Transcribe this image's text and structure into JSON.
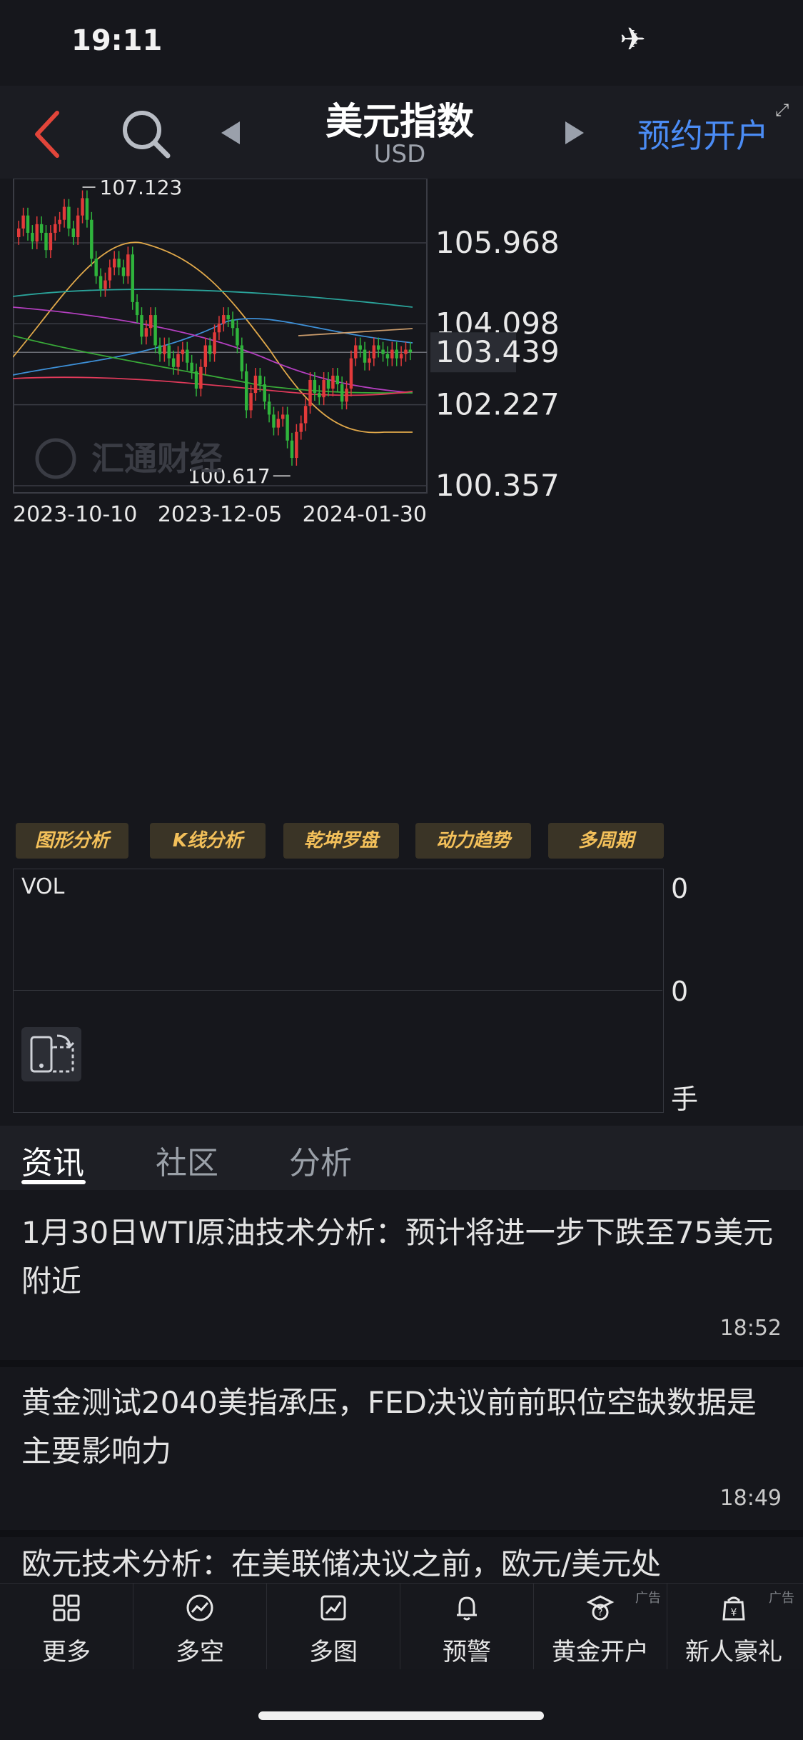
{
  "status_bar": {
    "time": "19:11"
  },
  "nav": {
    "title": "美元指数",
    "subtitle": "USD",
    "reserve_label": "预约开户"
  },
  "chart": {
    "y_axis_labels": [
      "105.968",
      "104.098",
      "103.439",
      "102.227",
      "100.357"
    ],
    "x_axis_labels": [
      "2023-10-10",
      "2023-12-05",
      "2024-01-30"
    ],
    "high_label": "107.123",
    "low_label": "100.617",
    "watermark": "汇通财经"
  },
  "chart_data": {
    "type": "candlestick",
    "x_start": "2023-10-10",
    "x_end": "2024-01-30",
    "ylim": [
      100.357,
      107.123
    ],
    "current": 103.439,
    "closes": [
      106.3,
      106.6,
      106.2,
      106.0,
      106.4,
      106.2,
      105.8,
      106.2,
      106.4,
      106.5,
      106.8,
      106.3,
      106.1,
      106.6,
      107.0,
      106.5,
      105.6,
      105.2,
      104.9,
      105.1,
      105.4,
      105.6,
      105.4,
      105.2,
      105.7,
      104.6,
      104.3,
      103.8,
      104.0,
      104.3,
      103.6,
      103.4,
      103.6,
      103.3,
      103.1,
      103.4,
      103.5,
      103.2,
      103.0,
      102.6,
      103.1,
      103.6,
      103.4,
      103.9,
      104.1,
      104.3,
      104.2,
      104.0,
      103.6,
      103.0,
      102.1,
      102.5,
      102.9,
      102.7,
      102.3,
      102.0,
      101.7,
      101.9,
      102.0,
      101.4,
      101.0,
      101.6,
      101.8,
      102.2,
      102.8,
      102.5,
      102.4,
      102.8,
      102.6,
      102.9,
      102.7,
      102.3,
      102.6,
      103.3,
      103.6,
      103.5,
      103.2,
      103.3,
      103.6,
      103.5,
      103.4,
      103.3,
      103.5,
      103.3,
      103.4,
      103.5,
      103.44
    ],
    "up_color": "#e23a3a",
    "down_color": "#2fb43c"
  },
  "chart_tabs": [
    "图形分析",
    "K线分析",
    "乾坤罗盘",
    "动力趋势",
    "多周期"
  ],
  "volume": {
    "label": "VOL",
    "axis_top": "0",
    "axis_mid": "0",
    "unit": "手"
  },
  "tabs": [
    "资讯",
    "社区",
    "分析"
  ],
  "news": [
    {
      "title": "1月30日WTI原油技术分析：预计将进一步下跌至75美元附近",
      "time": "18:52"
    },
    {
      "title": "黄金测试2040美指承压，FED决议前前职位空缺数据是主要影响力",
      "time": "18:49"
    },
    {
      "title": "欧元技术分析：在美联储决议之前，欧元/美元处",
      "time": ""
    }
  ],
  "bottom_nav": [
    {
      "label": "更多",
      "icon": "grid-icon",
      "ad": ""
    },
    {
      "label": "多空",
      "icon": "trend-circle-icon",
      "ad": ""
    },
    {
      "label": "多图",
      "icon": "chart-window-icon",
      "ad": ""
    },
    {
      "label": "预警",
      "icon": "bell-icon",
      "ad": ""
    },
    {
      "label": "黄金开户",
      "icon": "gold-account-icon",
      "ad": "广告"
    },
    {
      "label": "新人豪礼",
      "icon": "gift-bag-icon",
      "ad": "广告"
    }
  ],
  "colors": {
    "accent": "#4b8cf5",
    "back": "#e2453a",
    "tag_text": "#f3c05a"
  }
}
